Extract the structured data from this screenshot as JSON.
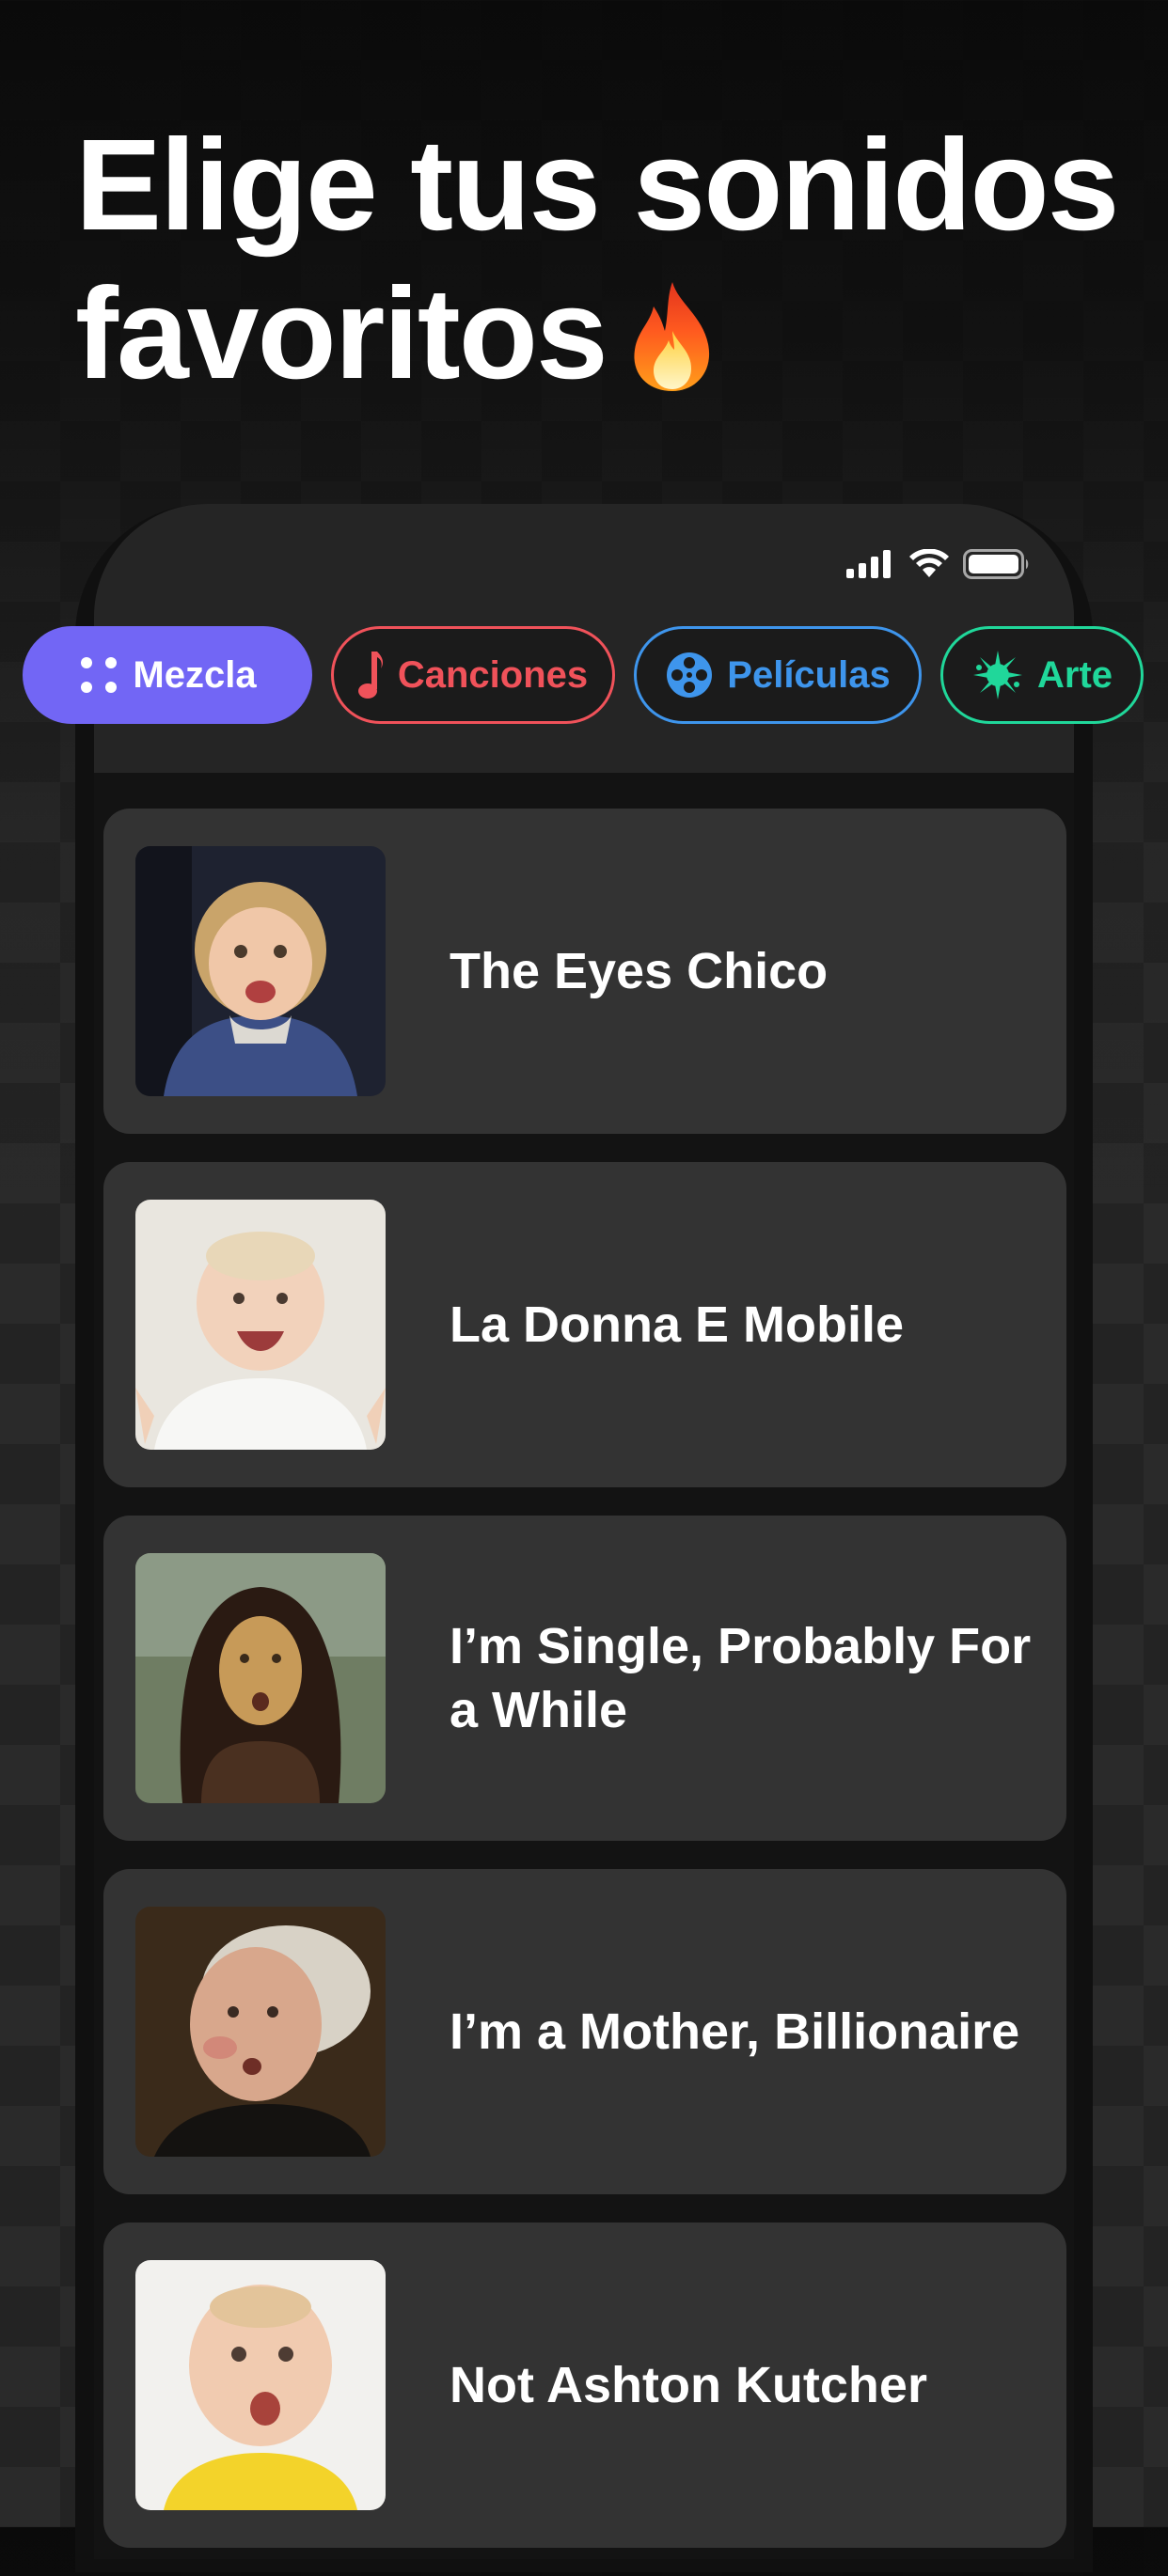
{
  "headline": {
    "line1": "Elige tus sonidos",
    "line2": "favoritos",
    "emoji": "fire-icon"
  },
  "status_bar": {
    "icons": [
      "signal-icon",
      "wifi-icon",
      "battery-icon"
    ]
  },
  "categories": [
    {
      "label": "Mezcla",
      "icon": "grid-dots-icon",
      "color": "#7266f5",
      "selected": true
    },
    {
      "label": "Canciones",
      "icon": "music-note-icon",
      "color": "#f0525a",
      "selected": false
    },
    {
      "label": "Películas",
      "icon": "film-reel-icon",
      "color": "#3e95ec",
      "selected": false
    },
    {
      "label": "Arte",
      "icon": "paint-splash-icon",
      "color": "#20d79a",
      "selected": false
    }
  ],
  "sounds": [
    {
      "title": "The Eyes Chico",
      "thumbnail": "child-singing-thumbnail"
    },
    {
      "title": "La Donna E Mobile",
      "thumbnail": "laughing-baby-thumbnail"
    },
    {
      "title": "I’m Single, Probably For a While",
      "thumbnail": "mona-lisa-thumbnail"
    },
    {
      "title": "I’m a Mother, Billionaire",
      "thumbnail": "george-washington-thumbnail"
    },
    {
      "title": "Not Ashton Kutcher",
      "thumbnail": "surprised-baby-thumbnail"
    }
  ],
  "colors": {
    "background": "#1c1c1c",
    "card": "#333333",
    "accent": "#7266f5"
  }
}
